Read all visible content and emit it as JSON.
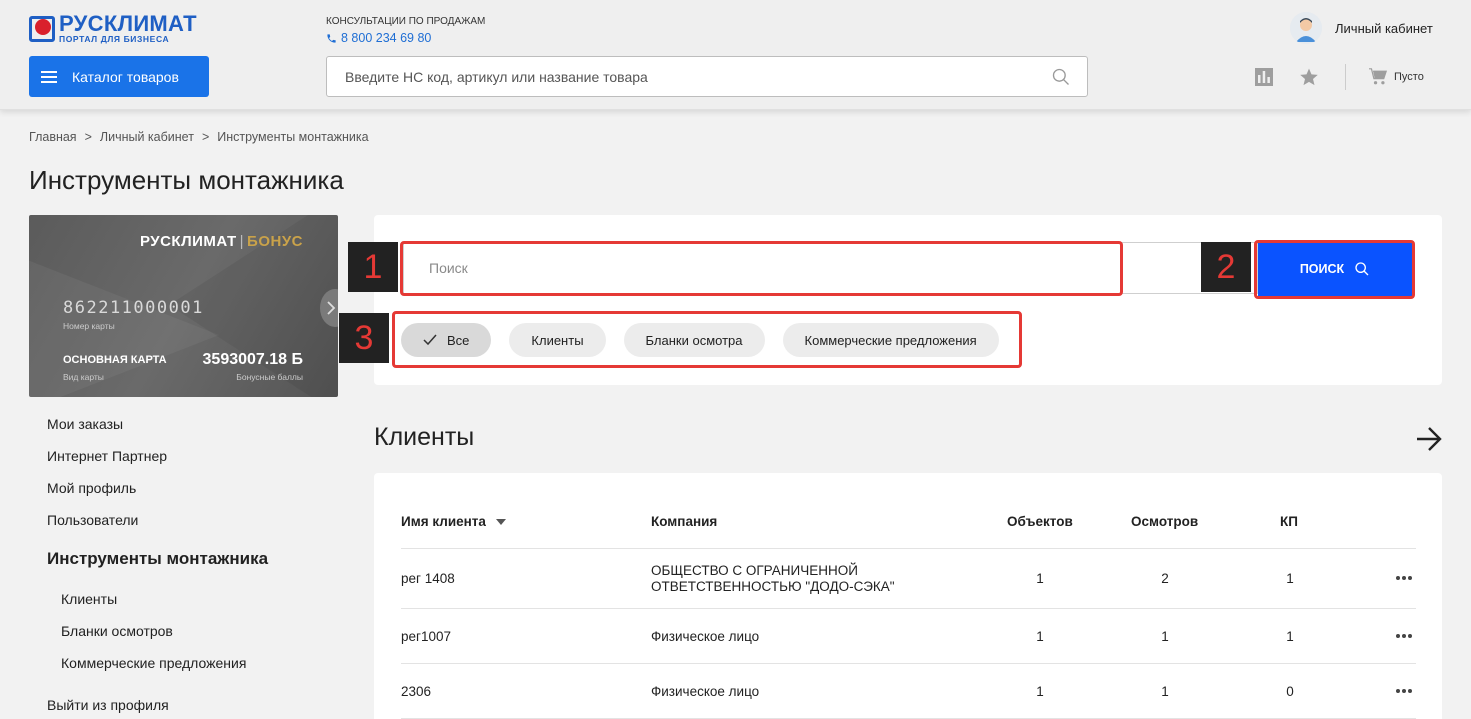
{
  "header": {
    "logo_title": "РУСКЛИМАТ",
    "logo_subtitle": "ПОРТАЛ ДЛЯ БИЗНЕСА",
    "consult_label": "КОНСУЛЬТАЦИИ ПО ПРОДАЖАМ",
    "phone": "8 800 234 69 80",
    "catalog_label": "Каталог товаров",
    "search_placeholder": "Введите НС код, артикул или название товара",
    "account_label": "Личный кабинет",
    "cart_label": "Пусто",
    "colors": {
      "accent": "#1a73e8",
      "brand_blue": "#1f5fc4",
      "brand_red": "#d9202c"
    }
  },
  "breadcrumb": [
    "Главная",
    ">",
    "Личный кабинет",
    ">",
    "Инструменты монтажника"
  ],
  "page_title": "Инструменты монтажника",
  "bonus_card": {
    "brand": "РУСКЛИМАТ",
    "separator": "|",
    "bonus": "БОНУС",
    "number": "862211000001",
    "number_label": "Номер карты",
    "type": "ОСНОВНАЯ КАРТА",
    "type_label": "Вид карты",
    "balance": "3593007.18 Б",
    "balance_label": "Бонусные баллы"
  },
  "sidebar": {
    "items": [
      "Мои заказы",
      "Интернет Партнер",
      "Мой профиль",
      "Пользователи"
    ],
    "section": "Инструменты монтажника",
    "sub_items": [
      "Клиенты",
      "Бланки осмотров",
      "Коммерческие предложения"
    ],
    "logout": "Выйти из профиля"
  },
  "search": {
    "placeholder": "Поиск",
    "button_label": "ПОИСК",
    "filters": [
      "Все",
      "Клиенты",
      "Бланки осмотра",
      "Коммерческие предложения"
    ],
    "active_filter": "Все"
  },
  "annotations": [
    "1",
    "2",
    "3"
  ],
  "clients": {
    "title": "Клиенты",
    "columns": [
      "Имя клиента",
      "Компания",
      "Объектов",
      "Осмотров",
      "КП"
    ],
    "rows": [
      {
        "name": "рег 1408",
        "company_line1": "ОБЩЕСТВО С ОГРАНИЧЕННОЙ",
        "company_line2": "ОТВЕТСТВЕННОСТЬЮ \"ДОДО-СЭКА\"",
        "objects": "1",
        "inspections": "2",
        "kp": "1"
      },
      {
        "name": "рег1007",
        "company_line1": "Физическое лицо",
        "company_line2": "",
        "objects": "1",
        "inspections": "1",
        "kp": "1"
      },
      {
        "name": "2306",
        "company_line1": "Физическое лицо",
        "company_line2": "",
        "objects": "1",
        "inspections": "1",
        "kp": "0"
      }
    ]
  }
}
